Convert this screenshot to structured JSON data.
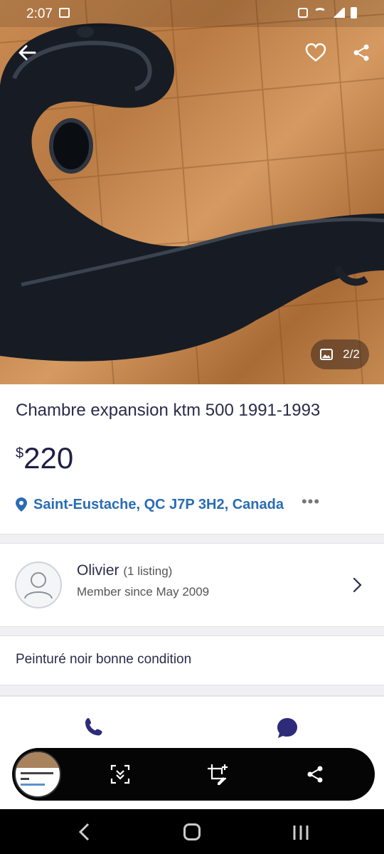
{
  "status_bar": {
    "time": "2:07"
  },
  "gallery": {
    "counter": "2/2"
  },
  "listing": {
    "title": "Chambre expansion ktm 500 1991-1993",
    "price_currency": "$",
    "price_amount": "220",
    "location": "Saint-Eustache, QC J7P 3H2, Canada",
    "more_label": "•••"
  },
  "seller": {
    "name": "Olivier",
    "listing_count": "(1 listing)",
    "member_since": "Member since May 2009"
  },
  "description": "Peinturé noir bonne condition",
  "icons": {
    "back": "back-arrow-icon",
    "favorite": "heart-icon",
    "share": "share-icon",
    "gallery": "image-icon",
    "location": "location-pin-icon",
    "phone": "phone-icon",
    "chat": "chat-bubble-icon",
    "scroll_capture": "scroll-capture-icon",
    "crop_edit": "crop-edit-icon",
    "toolbar_share": "share-icon"
  },
  "colors": {
    "accent_blue": "#2a6cb3",
    "brand_navy": "#2d2b7a",
    "text_dark": "#2b2b4a"
  }
}
